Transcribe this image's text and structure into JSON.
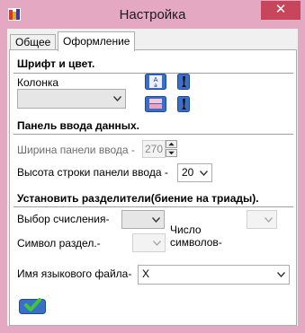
{
  "window": {
    "title": "Настройка",
    "close_glyph": "✕"
  },
  "tabs": [
    {
      "label": "Общее",
      "active": false
    },
    {
      "label": "Оформление",
      "active": true
    }
  ],
  "font_section": {
    "header": "Шрифт и цвет.",
    "column_label": "Колонка",
    "column_value": ""
  },
  "input_section": {
    "header": "Панель ввода данных.",
    "width_label": "Ширина панели ввода -",
    "width_value": "270",
    "height_label": "Высота строки панели ввода -",
    "height_value": "20"
  },
  "separator_section": {
    "header": "Установить разделители(биение на триады).",
    "calc_label": "Выбор счисления-",
    "calc_value": "",
    "number_label": "Число",
    "symbols_label": "символов-",
    "symbols_value": "",
    "sep_symbol_label": "Символ раздел.-",
    "sep_symbol_value": "",
    "lang_file_label": "Имя языкового файла-",
    "lang_file_value": "X"
  },
  "icons": {
    "font_icon": "font-a-icon",
    "color_icon": "color-swatch-icon",
    "brush_icon": "brush-icon",
    "ok_icon": "checkmark-icon"
  },
  "colors": {
    "frame": "#e5a8c3",
    "close": "#c7465c",
    "accent": "#3a6fc9"
  }
}
